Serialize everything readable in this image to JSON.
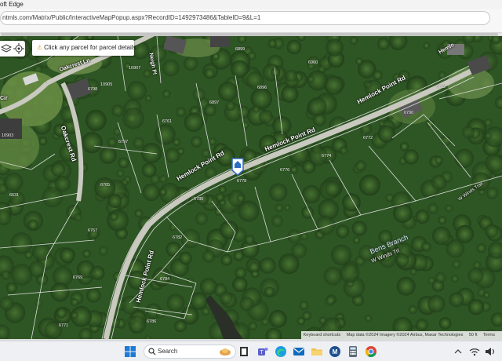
{
  "window": {
    "title": "oft Edge"
  },
  "browser": {
    "url": "ntmls.com/Matrix/Public/InteractiveMapPopup.aspx?RecordID=1492973486&TableID=9&L=1"
  },
  "map": {
    "tools": [
      {
        "icon": "layers-icon"
      },
      {
        "icon": "locate-icon"
      }
    ],
    "tooltip": {
      "icon": "warning-icon",
      "text": "Click any parcel for parcel details."
    },
    "roads": [
      {
        "text": "Hemlock Point Rd",
        "id": "r1"
      },
      {
        "text": "Hemlock Point Rd",
        "id": "r2"
      },
      {
        "text": "Hemlock Point Rd",
        "id": "r3"
      },
      {
        "text": "Hemlock Point Rd",
        "id": "r4"
      },
      {
        "text": "Oakcrest Rd",
        "id": "r5"
      },
      {
        "text": "Oakcrest Ln",
        "id": "r6"
      },
      {
        "text": "Neigh Pl",
        "id": "r7"
      },
      {
        "text": "Cir",
        "id": "r8"
      },
      {
        "text": "W Winds Trl",
        "id": "r9"
      },
      {
        "text": "W Winds Trail",
        "id": "r10"
      },
      {
        "text": "Hemlo",
        "id": "r11"
      }
    ],
    "water": {
      "text": "Bens Branch"
    },
    "parcels": [
      "6897",
      "6896",
      "6790",
      "6792",
      "6761",
      "6797",
      "6778",
      "6776",
      "6774",
      "6772",
      "6765",
      "6767",
      "6769",
      "6771",
      "6780",
      "6782",
      "6784",
      "6786",
      "6631",
      "10905",
      "10907",
      "6900",
      "6899",
      "10903",
      "6798"
    ],
    "attribution": [
      "Keyboard shortcuts",
      "Map data ©2024 Imagery ©2024 Airbus, Maxar Technologies",
      "50 ft",
      "Terms"
    ],
    "colors": {
      "foliage": "#2f5a26",
      "parcel_line": "#e6e6e6",
      "road": "#cfcfc8"
    }
  },
  "taskbar": {
    "search_placeholder": "Search",
    "icons": [
      "start-icon",
      "search-icon",
      "file-viewer-icon",
      "teams-icon",
      "edge-icon",
      "mail-icon",
      "file-explorer-icon",
      "m-app-icon",
      "calculator-icon",
      "chrome-icon"
    ],
    "tray": [
      "chevron-up-icon",
      "wifi-icon",
      "volume-icon"
    ]
  }
}
